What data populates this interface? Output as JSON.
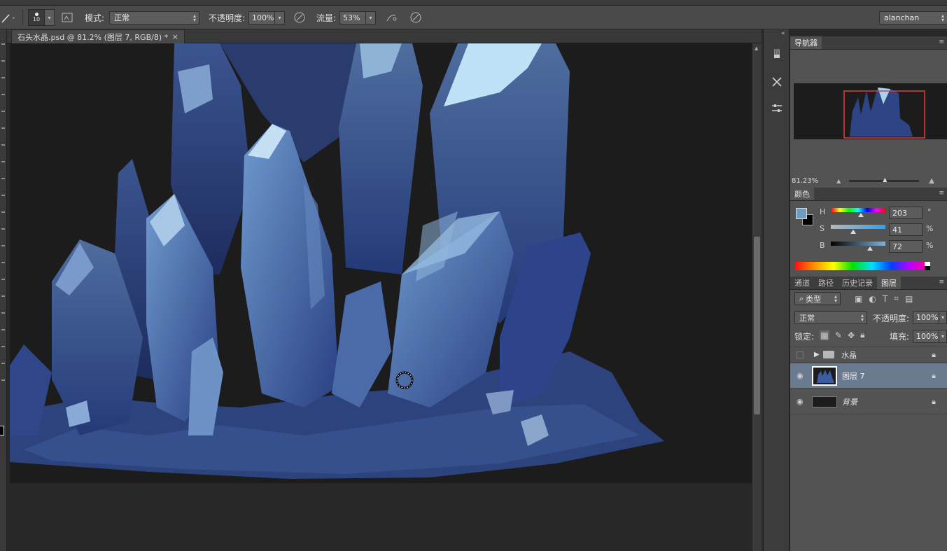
{
  "options_bar": {
    "brush_size": "10",
    "mode_label": "模式:",
    "mode_value": "正常",
    "opacity_label": "不透明度:",
    "opacity_value": "100%",
    "flow_label": "流量:",
    "flow_value": "53%",
    "workspace": "alanchan"
  },
  "document_tab": {
    "title": "石头水晶.psd @ 81.2% (图层 7, RGB/8) *",
    "close": "×"
  },
  "navigator": {
    "tab": "导航器",
    "zoom": "81.23%"
  },
  "color": {
    "tab": "颜色",
    "h_label": "H",
    "h_value": "203",
    "h_unit": "°",
    "s_label": "S",
    "s_value": "41",
    "s_unit": "%",
    "b_label": "B",
    "b_value": "72",
    "b_unit": "%",
    "foreground": "#6f9bbf",
    "background": "#000000",
    "h_fraction": 0.56,
    "s_fraction": 0.41,
    "b_fraction": 0.72
  },
  "layers_panel": {
    "tabs": [
      "通道",
      "路径",
      "历史记录",
      "图层"
    ],
    "filter_kind": "类型",
    "blend_mode": "正常",
    "opacity_label": "不透明度:",
    "opacity_value": "100%",
    "lock_label": "锁定:",
    "fill_label": "填充:",
    "fill_value": "100%",
    "layers": [
      {
        "name": "水晶",
        "type": "group"
      },
      {
        "name": "图层 7",
        "type": "layer",
        "selected": true
      },
      {
        "name": "背景",
        "type": "background"
      }
    ]
  }
}
